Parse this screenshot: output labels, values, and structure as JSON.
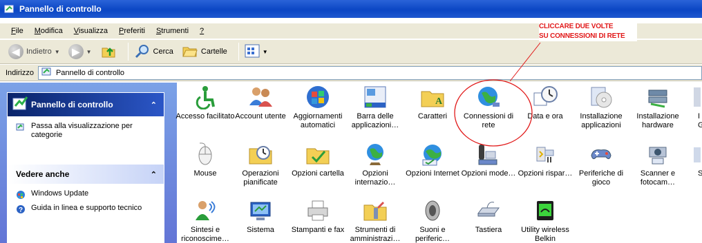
{
  "window": {
    "title": "Pannello di controllo"
  },
  "menu": [
    {
      "key": "F",
      "rest": "ile"
    },
    {
      "key": "M",
      "rest": "odifica"
    },
    {
      "key": "V",
      "rest": "isualizza"
    },
    {
      "key": "P",
      "rest": "referiti"
    },
    {
      "key": "S",
      "rest": "trumenti"
    },
    {
      "key": "?",
      "rest": ""
    }
  ],
  "toolbar": {
    "back": "Indietro",
    "search": "Cerca",
    "folders": "Cartelle"
  },
  "address": {
    "label": "Indirizzo",
    "value": "Pannello di controllo"
  },
  "leftpane": {
    "panel1": {
      "title": "Pannello di controllo",
      "task": "Passa alla visualizzazione per categorie"
    },
    "panel2": {
      "title": "Vedere anche",
      "items": [
        "Windows Update",
        "Guida in linea e supporto tecnico"
      ]
    }
  },
  "annotation": {
    "line1": "CLICCARE DUE VOLTE",
    "line2": "SU CONNESSIONI DI RETE"
  },
  "icons": [
    [
      "Accesso facilitato",
      "Account utente",
      "Aggiornamenti automatici",
      "Barra delle applicazioni…",
      "Caratteri",
      "Connessioni di rete",
      "Data e ora",
      "Installazione applicazioni",
      "Installazione hardware",
      "I Gr"
    ],
    [
      "Mouse",
      "Operazioni pianificate",
      "Opzioni cartella",
      "Opzioni internazio…",
      "Opzioni Internet",
      "Opzioni mode…",
      "Opzioni rispar…",
      "Periferiche di gioco",
      "Scanner e fotocam…",
      "S"
    ],
    [
      "Sintesi e riconoscime…",
      "Sistema",
      "Stampanti e fax",
      "Strumenti di amministrazi…",
      "Suoni e periferic…",
      "Tastiera",
      "Utility wireless Belkin"
    ]
  ]
}
